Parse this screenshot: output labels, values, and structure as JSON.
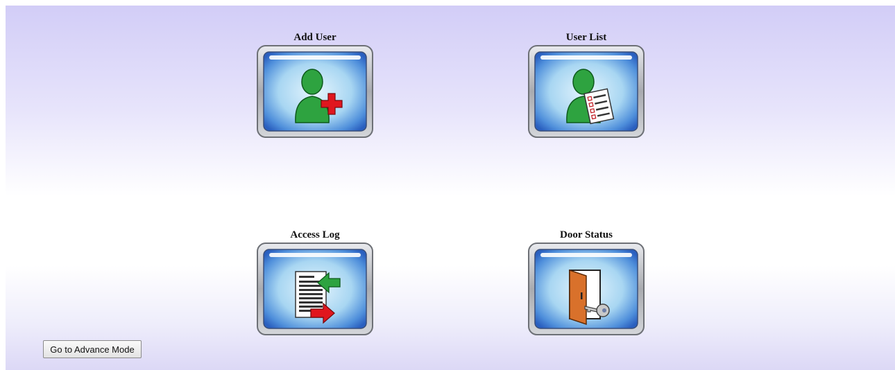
{
  "tiles": [
    {
      "label": "Add User",
      "icon": "add-user-icon"
    },
    {
      "label": "User List",
      "icon": "user-list-icon"
    },
    {
      "label": "Access Log",
      "icon": "access-log-icon"
    },
    {
      "label": "Door Status",
      "icon": "door-status-icon"
    }
  ],
  "advance_button": {
    "label": "Go to Advance Mode"
  },
  "colors": {
    "background_top": "#d2cdf7",
    "frame_gray": "#a9abb0",
    "screen_blue": "#3d7bd6",
    "person_green": "#2ea340",
    "accent_red": "#e0161e",
    "door_orange": "#d9712b"
  }
}
